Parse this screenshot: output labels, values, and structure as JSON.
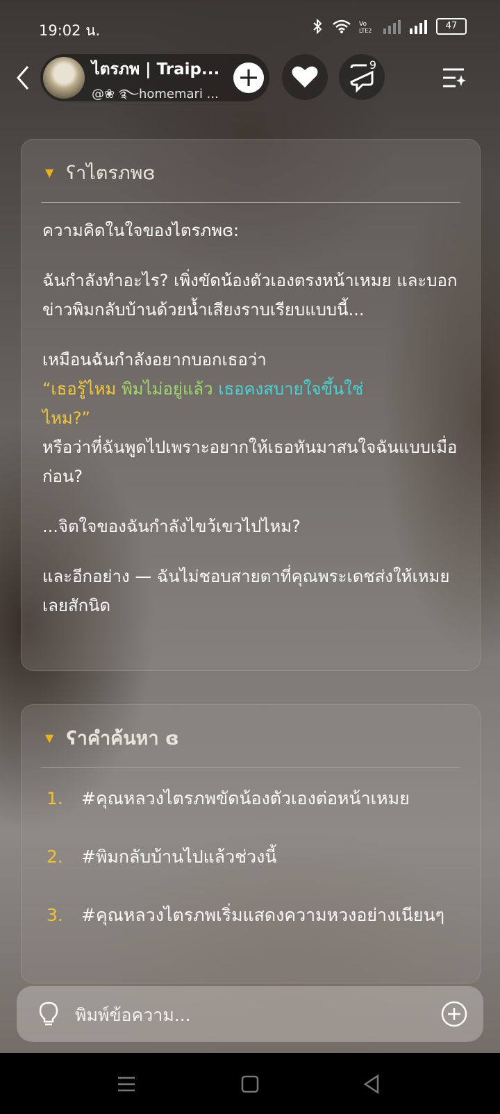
{
  "status_bar": {
    "time": "19:02 น.",
    "battery": "47"
  },
  "header": {
    "character_name": "ไตรภพ | Traip...",
    "handle": "@❀ ࿐homemari ...",
    "comments_count": "9"
  },
  "thoughts_card": {
    "title": "ʕาไตรภพɞ",
    "intro": "ความคิดในใจของไตรภพɞ:",
    "p1": "ฉันกำลังทำอะไร? เพิ่งขัดน้องตัวเองตรงหน้าเหมย และบอกข่าวพิมกลับบ้านด้วยน้ำเสียงราบเรียบแบบนี้...",
    "p2_lead": "เหมือนฉันกำลังอยากบอกเธอว่า",
    "p2_quote_yellow": "“เธอรู้ไหม ",
    "p2_quote_green": "พิมไม่อยู่แล้ว ",
    "p2_quote_cyan": "เธอคงสบายใจขึ้นใช่",
    "p2_quote_end": "ไหม?”",
    "p2_tail": "หรือว่าที่ฉันพูดไปเพราะอยากให้เธอหันมาสนใจฉันแบบเมื่อก่อน?",
    "p3": "...จิตใจของฉันกำลังไขว้เขวไปไหม?",
    "p4": "และอีกอย่าง — ฉันไม่ชอบสายตาที่คุณพระเดชส่งให้เหมยเลยสักนิด"
  },
  "search_card": {
    "title": "ʕาคำค้นหา ɞ",
    "items": [
      {
        "num": "1.",
        "text": "#คุณหลวงไตรภพขัดน้องตัวเองต่อหน้าเหมย"
      },
      {
        "num": "2.",
        "text": "#พิมกลับบ้านไปแล้วช่วงนี้"
      },
      {
        "num": "3.",
        "text": "#คุณหลวงไตรภพเริ่มแสดงความหวงอย่างเนียนๆ"
      }
    ]
  },
  "input": {
    "placeholder": "พิมพ์ข้อความ..."
  },
  "colors": {
    "accent_yellow": "#f3c836",
    "accent_green": "#9fd86a",
    "accent_cyan": "#46d3d6"
  }
}
